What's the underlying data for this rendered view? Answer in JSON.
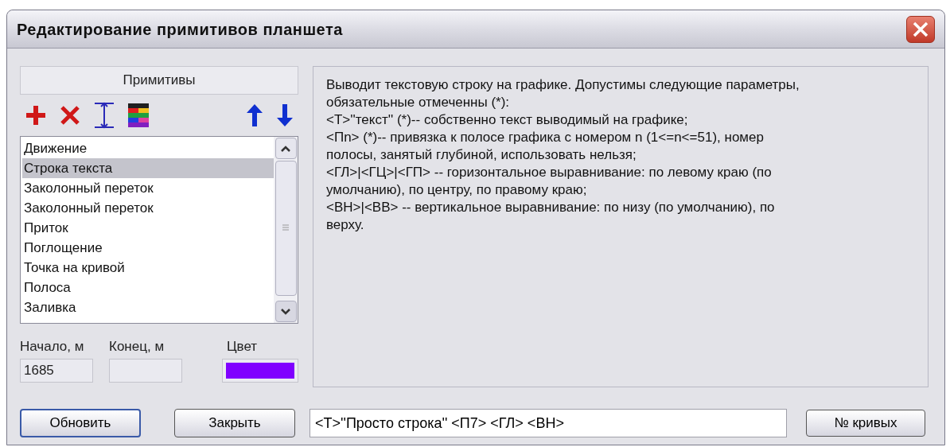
{
  "window": {
    "title": "Редактирование примитивов планшета"
  },
  "primitives": {
    "header": "Примитивы",
    "items": [
      {
        "label": "Движение",
        "selected": false
      },
      {
        "label": "Строка текста",
        "selected": true
      },
      {
        "label": "Заколонный переток",
        "selected": false
      },
      {
        "label": "Заколонный переток",
        "selected": false
      },
      {
        "label": "Приток",
        "selected": false
      },
      {
        "label": "Поглощение",
        "selected": false
      },
      {
        "label": "Точка на кривой",
        "selected": false
      },
      {
        "label": "Полоса",
        "selected": false
      },
      {
        "label": "Заливка",
        "selected": false
      }
    ]
  },
  "fields": {
    "start": {
      "label": "Начало, м",
      "value": "1685"
    },
    "end": {
      "label": "Конец, м"
    },
    "color": {
      "label": "Цвет",
      "color": "#8000ff"
    }
  },
  "description": [
    "Выводит текстовую строку на графике. Допустимы следующие параметры, обязательные отмеченны (*):",
    "<Т>''текст'' (*)-- собственно текст выводимый на графике;",
    "<Пn> (*)-- привязка к полосе графика с номером n (1<=n<=51), номер полосы, занятый глубиной, использовать нельзя;",
    "<ГЛ>|<ГЦ>|<ГП> -- горизонтальное выравнивание: по левому краю (по умолчанию), по центру, по правому краю;",
    "<ВН>|<ВВ> -- вертикальное выравнивание: по низу (по умолчанию), по верху."
  ],
  "buttons": {
    "refresh": "Обновить",
    "close": "Закрыть",
    "curves": "№ кривых"
  },
  "command": {
    "value": "<Т>''Просто строка'' <П7> <ГЛ> <ВН>"
  }
}
